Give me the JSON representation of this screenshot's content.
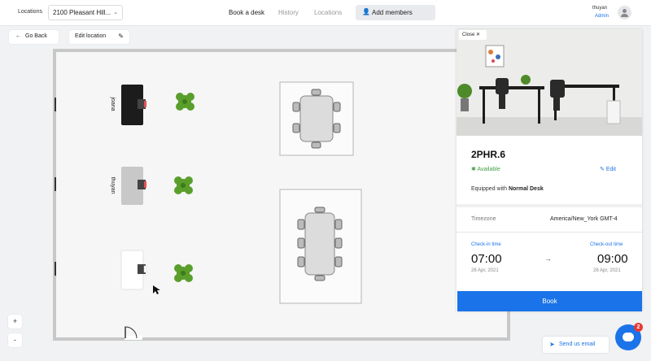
{
  "header": {
    "locations_label": "Locations",
    "location_value": "2100 Pleasant Hill...",
    "tabs": [
      {
        "label": "Book a desk",
        "active": true
      },
      {
        "label": "History",
        "active": false
      },
      {
        "label": "Locations",
        "active": false
      }
    ],
    "add_members_label": "Add members",
    "user": {
      "name": "thuyan",
      "role": "Admin"
    }
  },
  "toolbar": {
    "go_back_label": "Go Back",
    "edit_location_label": "Edit location"
  },
  "map": {
    "desks": [
      {
        "label": "joana",
        "status": "occupied"
      },
      {
        "label": "thuyan",
        "status": "selected"
      },
      {
        "label": "",
        "status": "available"
      }
    ],
    "zoom_in": "+",
    "zoom_out": "-"
  },
  "panel": {
    "close_label": "Close",
    "desk_name": "2PHR.6",
    "status": "Available",
    "edit_label": "Edit",
    "equipped_prefix": "Equipped with",
    "equipped_value": "Normal Desk",
    "timezone_label": "Timezone",
    "timezone_value": "America/New_York GMT-4",
    "checkin_label": "Check-in time",
    "checkout_label": "Check-out time",
    "checkin_time": "07:00",
    "checkout_time": "09:00",
    "checkin_date": "26 Apr, 2021",
    "checkout_date": "26 Apr, 2021",
    "book_label": "Book"
  },
  "footer": {
    "send_email_label": "Send us email",
    "chat_badge": "2"
  },
  "colors": {
    "accent": "#1a73e8",
    "available": "#43a047",
    "badge": "#e53935"
  }
}
